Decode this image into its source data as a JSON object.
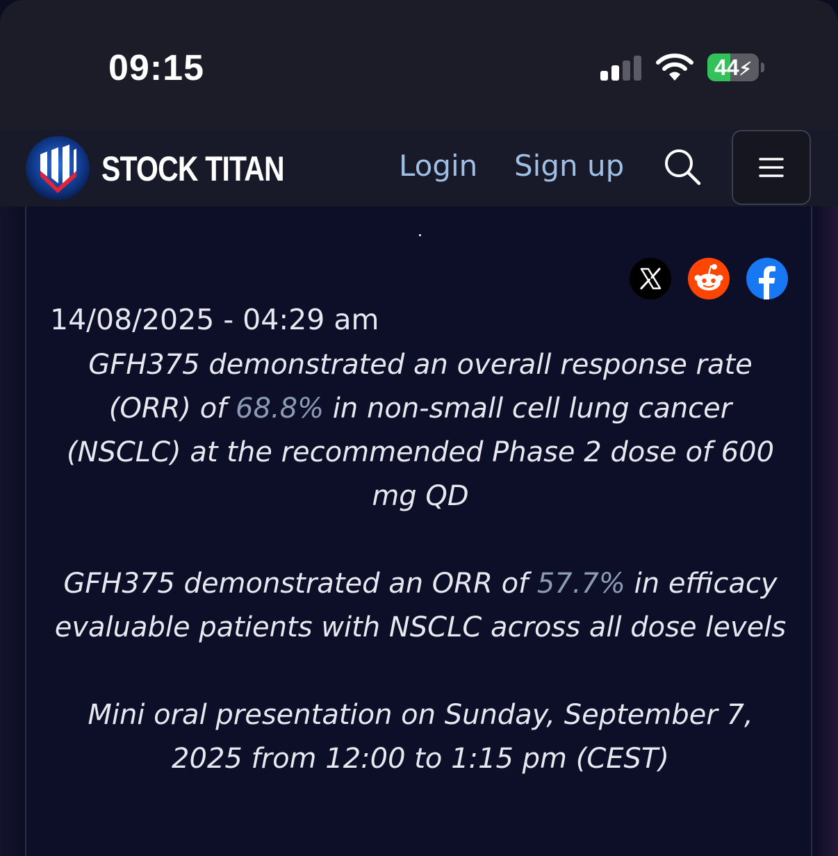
{
  "status_bar": {
    "time": "09:15",
    "battery_level": "44",
    "signal_bars_active": 2,
    "signal_bars_total": 4
  },
  "navbar": {
    "brand": "STOCK TITAN",
    "login_label": "Login",
    "signup_label": "Sign up",
    "icons": [
      "stock-titan-logo",
      "search-icon",
      "hamburger-menu-icon"
    ]
  },
  "article": {
    "share_icons": [
      "x-icon",
      "reddit-icon",
      "facebook-icon"
    ],
    "date": "14/08/2025 - 04:29 am",
    "bullets": [
      {
        "before": "GFH375 demonstrated an overall response rate (ORR) of ",
        "highlight": "68.8%",
        "after": " in non-small cell lung cancer (NSCLC) at the recommended Phase 2 dose of 600 mg QD"
      },
      {
        "before": "GFH375 demonstrated an ORR of ",
        "highlight": "57.7%",
        "after": " in efficacy evaluable patients with NSCLC across all dose levels"
      },
      {
        "before": "Mini oral presentation on Sunday, September 7, 2025 from 12:00 to 1:15 pm (CEST)",
        "highlight": "",
        "after": ""
      }
    ]
  },
  "colors": {
    "status_bg": "#1b1c28",
    "nav_bg": "#181a2a",
    "link": "#9fc0e4",
    "highlight": "#8b9bb4",
    "battery_green": "#33c25a"
  }
}
